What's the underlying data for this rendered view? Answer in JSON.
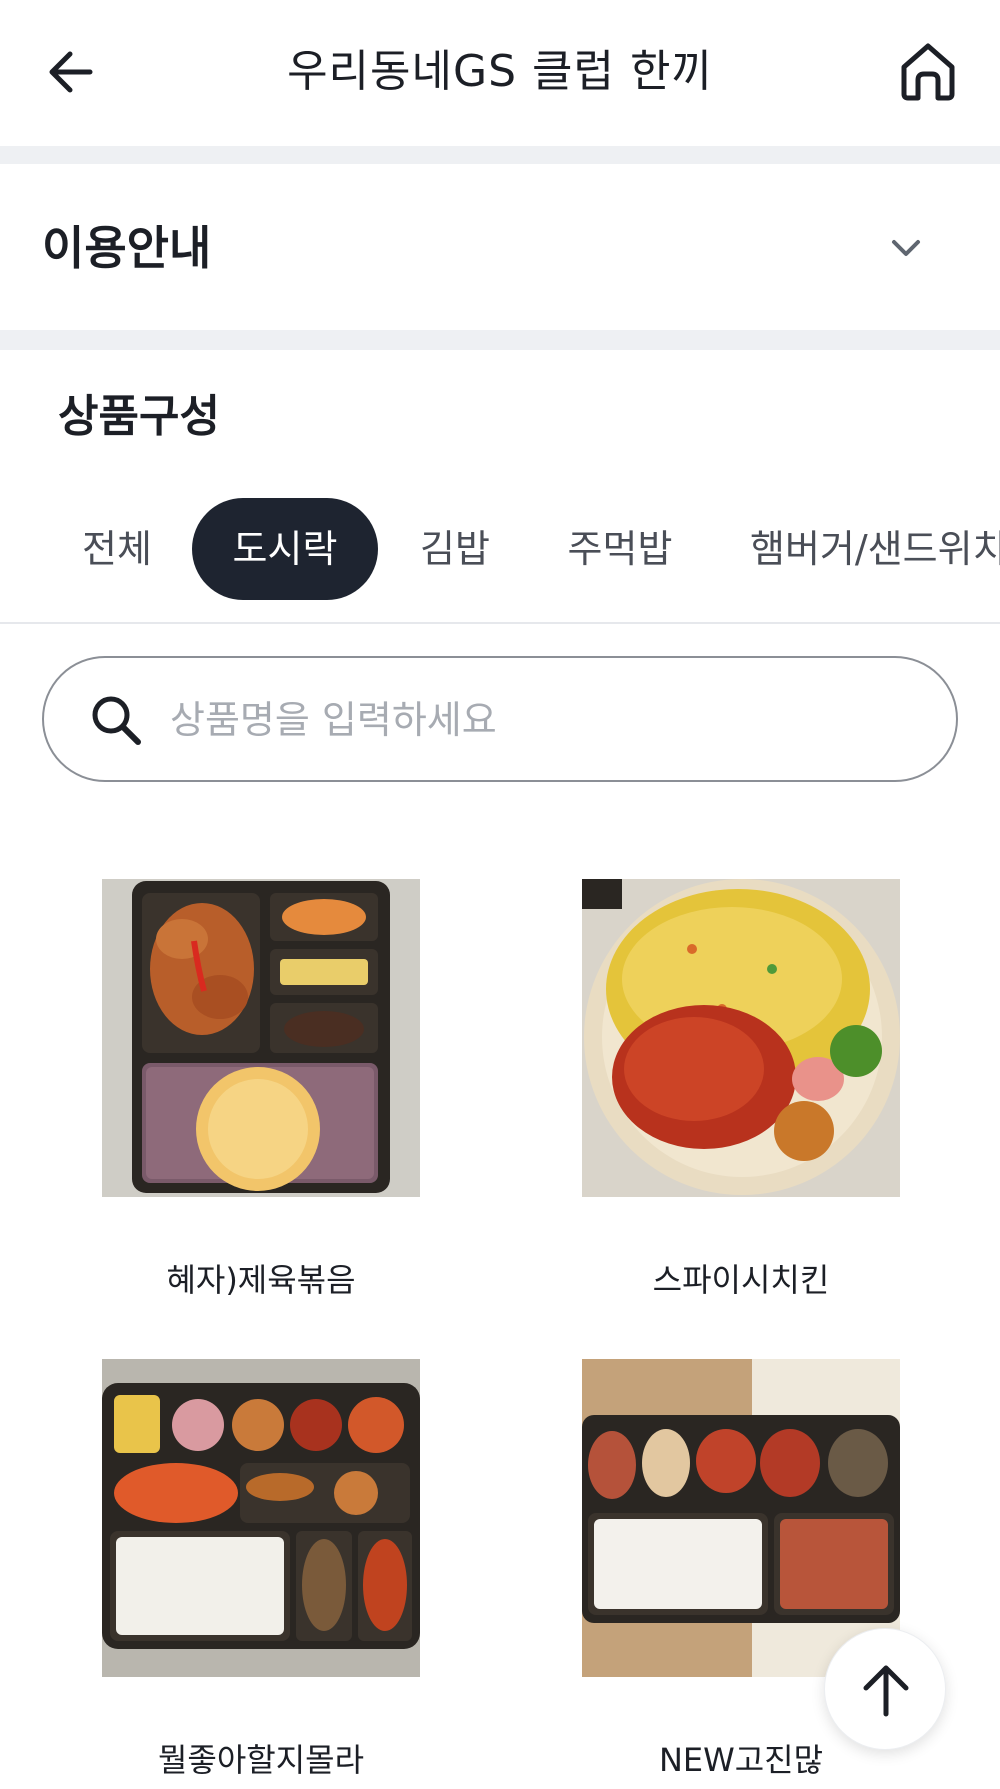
{
  "header": {
    "title": "우리동네GS 클럽 한끼",
    "back_icon": "arrow-left-icon",
    "home_icon": "home-icon"
  },
  "info": {
    "title": "이용안내",
    "chevron_icon": "chevron-down-icon"
  },
  "products": {
    "title": "상품구성",
    "tabs": [
      {
        "label": "전체",
        "active": false
      },
      {
        "label": "도시락",
        "active": true
      },
      {
        "label": "김밥",
        "active": false
      },
      {
        "label": "주먹밥",
        "active": false
      },
      {
        "label": "햄버거/샌드위치",
        "active": false
      }
    ],
    "search": {
      "placeholder": "상품명을 입력하세요",
      "value": "",
      "icon": "search-icon"
    },
    "items": [
      {
        "name": "혜자)제육볶음",
        "image": "dosirak-box-photo"
      },
      {
        "name": "스파이시치킨",
        "image": "rice-plate-photo"
      },
      {
        "name": "뭘좋아할지몰라",
        "image": "dosirak-box-photo"
      },
      {
        "name": "NEW고진많",
        "image": "dosirak-box-photo"
      }
    ]
  },
  "scroll_top": {
    "icon": "arrow-up-icon"
  },
  "colors": {
    "accent": "#1e2430",
    "divider": "#eef0f3",
    "placeholder": "#a7abb2"
  }
}
